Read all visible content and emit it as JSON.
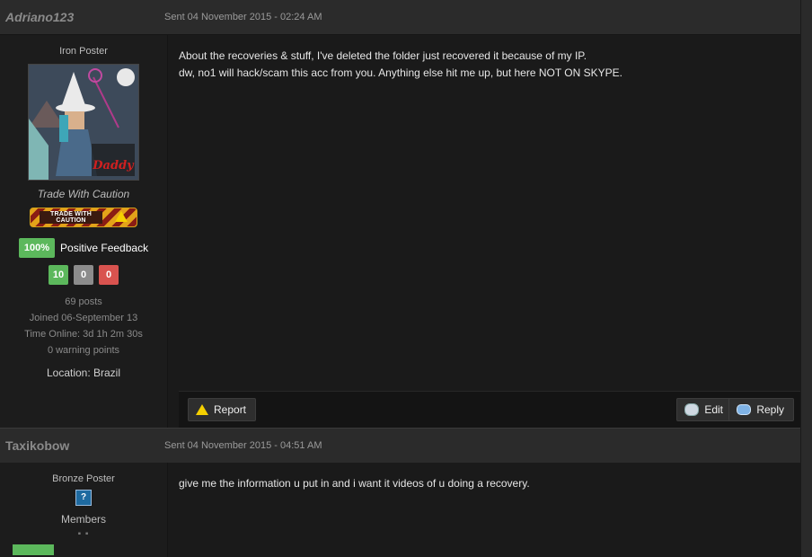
{
  "post1": {
    "username": "Adriano123",
    "date": "Sent 04 November 2015 - 02:24 AM",
    "rank": "Iron Poster",
    "user_title": "Trade With Caution",
    "badge_text": "TRADE WITH CAUTION",
    "avatar_text": "Daddy",
    "feedback_pct": "100%",
    "feedback_label": "Positive Feedback",
    "positive": "10",
    "neutral": "0",
    "negative": "0",
    "posts": "69 posts",
    "joined": "Joined 06-September 13",
    "time_online": "Time Online: 3d 1h 2m 30s",
    "warning": "0 warning points",
    "location": "Location: Brazil",
    "message_line1": "About the recoveries & stuff, I've deleted the folder just recovered it because of my IP.",
    "message_line2": "dw, no1 will hack/scam this acc from you. Anything else hit me up, but here NOT ON SKYPE.",
    "report_label": "Report",
    "edit_label": "Edit",
    "reply_label": "Reply"
  },
  "post2": {
    "username": "Taxikobow",
    "date": "Sent 04 November 2015 - 04:51 AM",
    "rank": "Bronze Poster",
    "group_icon_glyph": "?",
    "group_name": "Members",
    "message": "give me the information u put in and i want it videos of u doing a recovery."
  },
  "colors": {
    "positive": "#5cb85c",
    "neutral": "#8c8c8c",
    "negative": "#d9534f",
    "background": "#1f1f1f"
  }
}
